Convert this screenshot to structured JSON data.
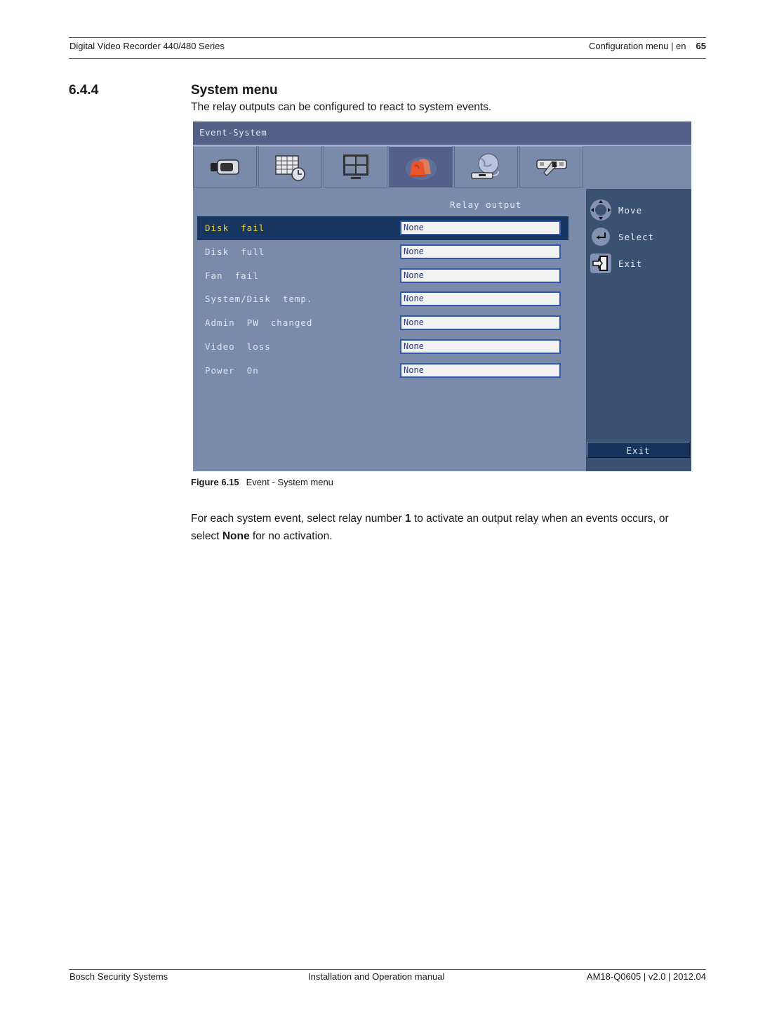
{
  "header": {
    "doc_title": "Digital Video Recorder 440/480 Series",
    "section_label": "Configuration menu | en",
    "page_number": "65"
  },
  "section": {
    "number": "6.4.4",
    "title": "System menu",
    "intro": "The relay outputs can be configured to react to system events."
  },
  "dvr_screen": {
    "title": "Event-System",
    "tabs": [
      {
        "icon": "camera-icon",
        "active": false
      },
      {
        "icon": "schedule-icon",
        "active": false
      },
      {
        "icon": "monitor-icon",
        "active": false
      },
      {
        "icon": "alarm-light-icon",
        "active": true
      },
      {
        "icon": "network-icon",
        "active": false
      },
      {
        "icon": "system-tools-icon",
        "active": false
      }
    ],
    "column_header": "Relay output",
    "rows": [
      {
        "label": "Disk  fail",
        "value": "None",
        "selected": true
      },
      {
        "label": "Disk  full",
        "value": "None",
        "selected": false
      },
      {
        "label": "Fan  fail",
        "value": "None",
        "selected": false
      },
      {
        "label": "System/Disk  temp.",
        "value": "None",
        "selected": false
      },
      {
        "label": "Admin  PW  changed",
        "value": "None",
        "selected": false
      },
      {
        "label": "Video  loss",
        "value": "None",
        "selected": false
      },
      {
        "label": "Power  On",
        "value": "None",
        "selected": false
      }
    ],
    "hints": [
      {
        "icon": "move-arrows-icon",
        "label": "Move"
      },
      {
        "icon": "enter-icon",
        "label": "Select"
      },
      {
        "icon": "exit-door-icon",
        "label": "Exit"
      }
    ],
    "exit_button": "Exit"
  },
  "figure": {
    "label": "Figure  6.15",
    "caption": "Event - System menu"
  },
  "body": {
    "p1_a": "For each system event, select relay number ",
    "p1_b1": "1",
    "p1_c": " to activate an output relay when an events occurs, or select ",
    "p1_b2": "None",
    "p1_d": " for no activation."
  },
  "footer": {
    "left": "Bosch Security Systems",
    "center": "Installation and Operation manual",
    "right": "AM18-Q0605 | v2.0 | 2012.04"
  }
}
